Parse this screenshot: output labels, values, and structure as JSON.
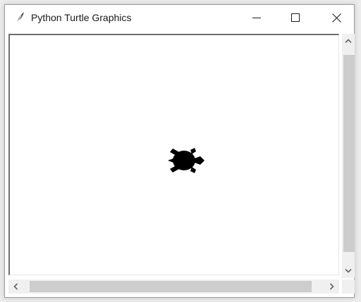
{
  "window": {
    "title": "Python Turtle Graphics",
    "app_icon": "feather-icon"
  },
  "titlebar": {
    "minimize_icon": "minimize-icon",
    "maximize_icon": "maximize-icon",
    "close_icon": "close-icon"
  },
  "canvas": {
    "background": "#ffffff",
    "turtle_color": "#000000",
    "turtle_icon": "turtle-icon",
    "turtle_heading": "east"
  },
  "scrollbars": {
    "vertical": {
      "up_icon": "chevron-up-icon",
      "down_icon": "chevron-down-icon"
    },
    "horizontal": {
      "left_icon": "chevron-left-icon",
      "right_icon": "chevron-right-icon"
    }
  }
}
